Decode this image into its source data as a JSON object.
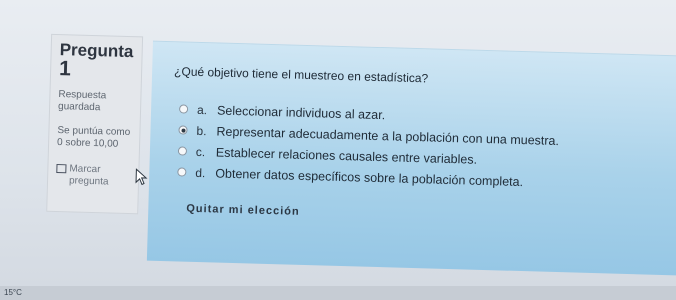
{
  "question": {
    "label": "Pregunta",
    "number": "1",
    "status": "Respuesta guardada",
    "score": "Se puntúa como 0 sobre 10,00",
    "flag_label": "Marcar pregunta",
    "text": "¿Qué objetivo tiene el muestreo en estadística?"
  },
  "answers": [
    {
      "letter": "a.",
      "text": "Seleccionar individuos al azar.",
      "selected": false
    },
    {
      "letter": "b.",
      "text": "Representar adecuadamente a la población con una muestra.",
      "selected": true
    },
    {
      "letter": "c.",
      "text": "Establecer relaciones causales entre variables.",
      "selected": false
    },
    {
      "letter": "d.",
      "text": "Obtener datos específicos sobre la población completa.",
      "selected": false
    }
  ],
  "clear_choice": "Quitar mi elección",
  "taskbar": {
    "temperature": "15°C"
  },
  "colors": {
    "accent_bg": "#a9d2ea",
    "info_bg": "#e4e7eb"
  },
  "icons": {
    "flag": "flag-icon",
    "cursor": "mouse-pointer-icon"
  }
}
